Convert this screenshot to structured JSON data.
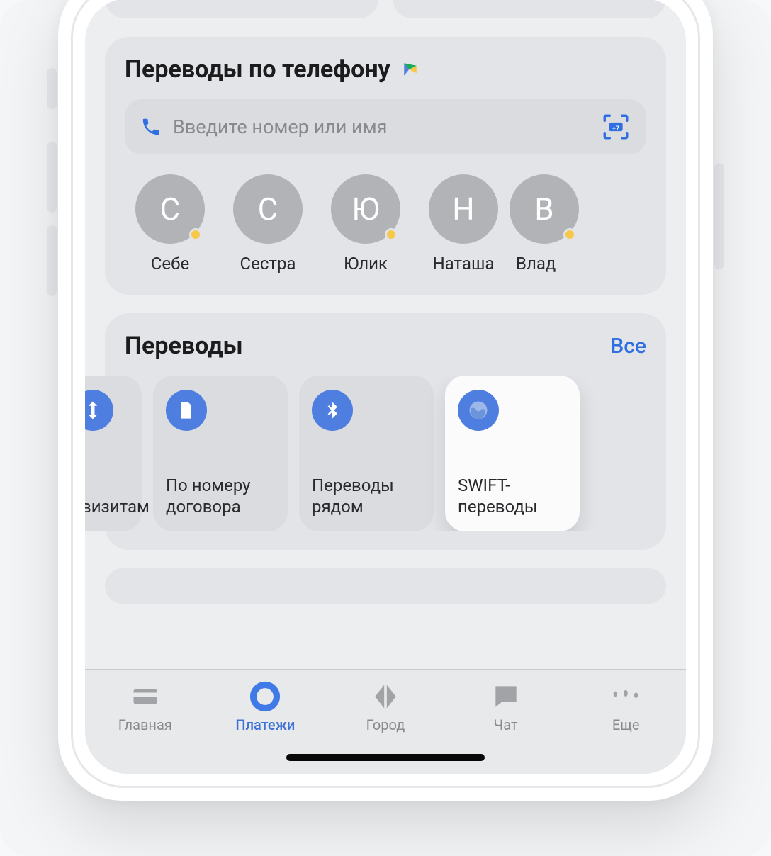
{
  "phone_transfers": {
    "title": "Переводы по телефону",
    "input_placeholder": "Введите номер или имя",
    "scan_badge": "+7",
    "contacts": [
      {
        "initial": "С",
        "name": "Себе",
        "dot": true
      },
      {
        "initial": "С",
        "name": "Сестра",
        "dot": false
      },
      {
        "initial": "Ю",
        "name": "Юлик",
        "dot": true
      },
      {
        "initial": "Н",
        "name": "Наташа",
        "dot": false
      },
      {
        "initial": "В",
        "name": "Влад",
        "dot": true
      }
    ]
  },
  "transfers": {
    "title": "Переводы",
    "all_label": "Все",
    "tiles": [
      {
        "label": "квизитам",
        "icon": "arrows",
        "active": false,
        "cut": true
      },
      {
        "label": "По номеру\nдоговора",
        "icon": "doc",
        "active": false
      },
      {
        "label": "Переводы\nрядом",
        "icon": "bluetooth",
        "active": false
      },
      {
        "label": "SWIFT-\nпереводы",
        "icon": "globe",
        "active": true
      }
    ]
  },
  "tabs": {
    "items": [
      {
        "label": "Главная",
        "icon": "card",
        "active": false
      },
      {
        "label": "Платежи",
        "icon": "circle",
        "active": true
      },
      {
        "label": "Город",
        "icon": "diamond",
        "active": false
      },
      {
        "label": "Чат",
        "icon": "chat",
        "active": false
      },
      {
        "label": "Еще",
        "icon": "more",
        "active": false
      }
    ]
  }
}
